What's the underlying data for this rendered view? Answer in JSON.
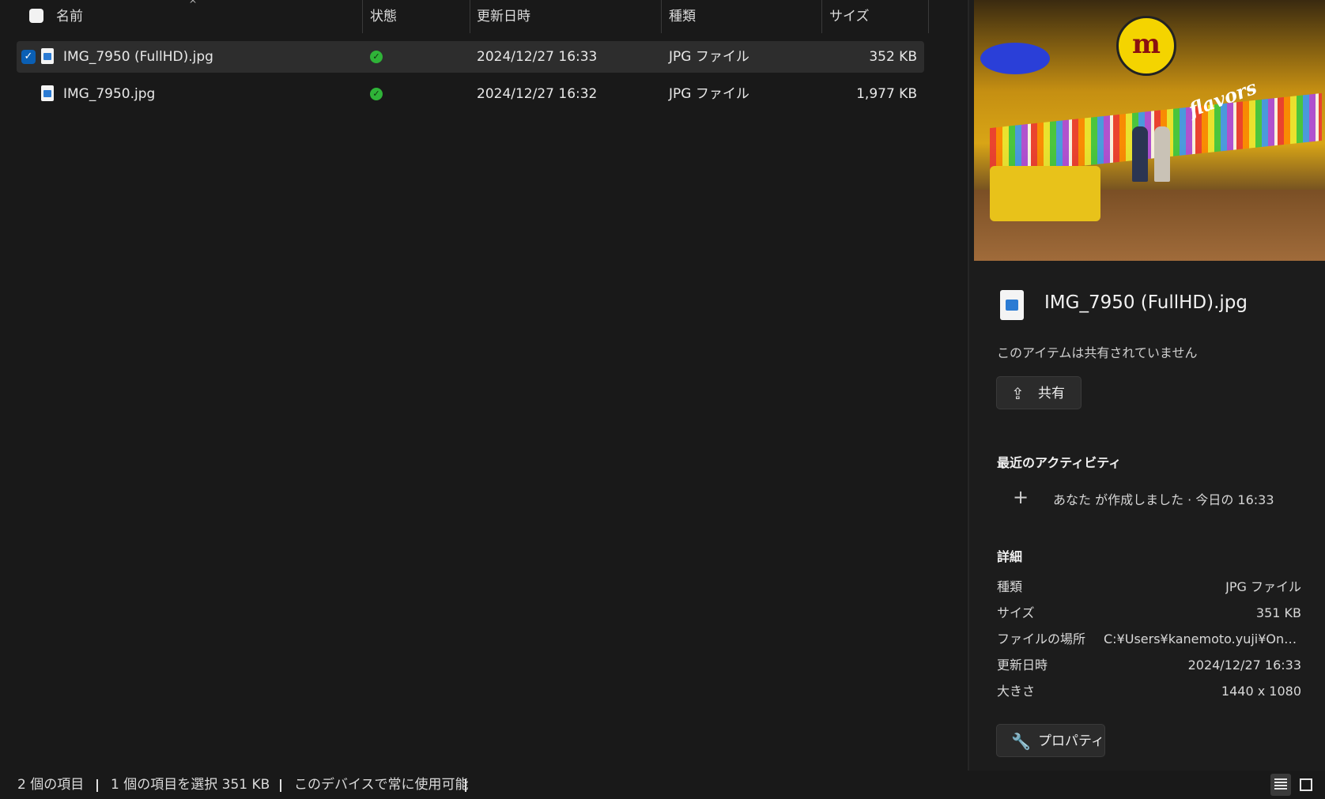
{
  "columns": {
    "name": "名前",
    "status": "状態",
    "modified": "更新日時",
    "type": "種類",
    "size": "サイズ"
  },
  "files": [
    {
      "name": "IMG_7950 (FullHD).jpg",
      "modified": "2024/12/27 16:33",
      "type": "JPG ファイル",
      "size": "352 KB",
      "selected": true
    },
    {
      "name": "IMG_7950.jpg",
      "modified": "2024/12/27 16:32",
      "type": "JPG ファイル",
      "size": "1,977 KB",
      "selected": false
    }
  ],
  "icons": {
    "file": "image-file-icon",
    "status_ok": "checkmark-circle-icon",
    "share": "share-icon",
    "properties": "wrench-icon",
    "activity": "plus-icon",
    "sort": "chevron-up-icon"
  },
  "details": {
    "title": "IMG_7950 (FullHD).jpg",
    "share_status": "このアイテムは共有されていません",
    "share_button": "共有",
    "activity_heading": "最近のアクティビティ",
    "activity_item": "あなた が作成しました · 今日の 16:33",
    "details_heading": "詳細",
    "properties": [
      {
        "key": "種類",
        "value": "JPG ファイル"
      },
      {
        "key": "サイズ",
        "value": "351 KB"
      },
      {
        "key": "ファイルの場所",
        "value": "C:¥Users¥kanemoto.yuji¥One..."
      },
      {
        "key": "更新日時",
        "value": "2024/12/27 16:33"
      },
      {
        "key": "大きさ",
        "value": "1440 x 1080"
      }
    ],
    "properties_button": "プロパティ",
    "preview_sign_text": "m",
    "preview_flavors_text": "flavors"
  },
  "statusbar": {
    "item_count": "2 個の項目",
    "selection": "1 個の項目を選択  351 KB",
    "availability": "このデバイスで常に使用可能"
  },
  "colors": {
    "background": "#191919",
    "accent": "#0a5fb4",
    "status_green": "#2fb338"
  }
}
